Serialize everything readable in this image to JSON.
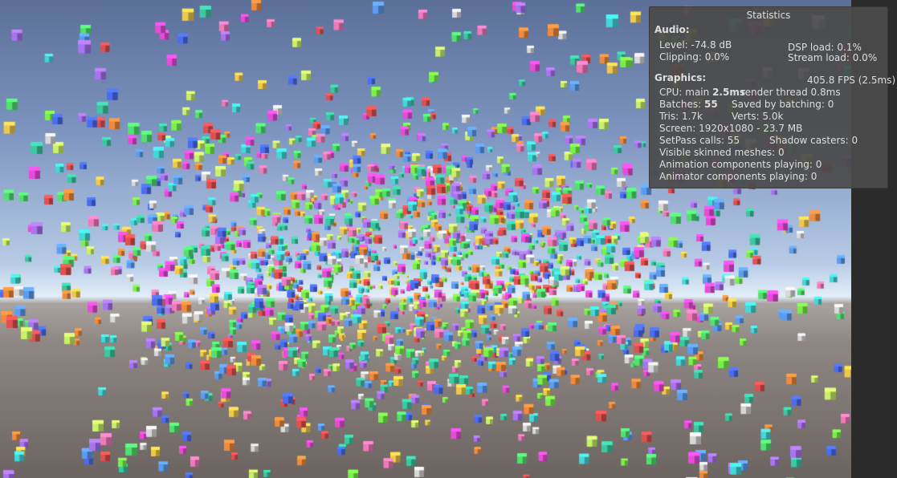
{
  "window": {
    "title": "Statistics"
  },
  "audio": {
    "heading": "Audio:",
    "level": "Level: -74.8 dB",
    "clipping": "Clipping: 0.0%",
    "dsp_load": "DSP load: 0.1%",
    "stream_load": "Stream load: 0.0%"
  },
  "graphics": {
    "heading": "Graphics:",
    "fps": "405.8 FPS (2.5ms)",
    "cpu_label": "CPU: main ",
    "cpu_main": "2.5ms",
    "render_thread": "render thread 0.8ms",
    "batches_label": "Batches: ",
    "batches": "55",
    "saved_by_batching": "Saved by batching: 0",
    "tris": "Tris: 1.7k",
    "verts": "Verts: 5.0k",
    "screen": "Screen: 1920x1080 - 23.7 MB",
    "setpass": "SetPass calls: 55",
    "shadow_casters": "Shadow casters: 0",
    "skinned_meshes": "Visible skinned meshes: 0",
    "animation_components": "Animation components playing: 0",
    "animator_components": "Animator components playing: 0"
  },
  "scene": {
    "sky_top": "#5b6f98",
    "horizon": "#e2eef8",
    "ground": "#8d8683",
    "cube_palette": [
      "#e84bd8",
      "#52e070",
      "#5d9cf0",
      "#f0c84a",
      "#e05050",
      "#45d6d6",
      "#a874f0",
      "#f08a3c",
      "#7af04a",
      "#f07ab8",
      "#4a6cf0",
      "#d8d8d8",
      "#c8f06a",
      "#3cc8a0"
    ]
  }
}
